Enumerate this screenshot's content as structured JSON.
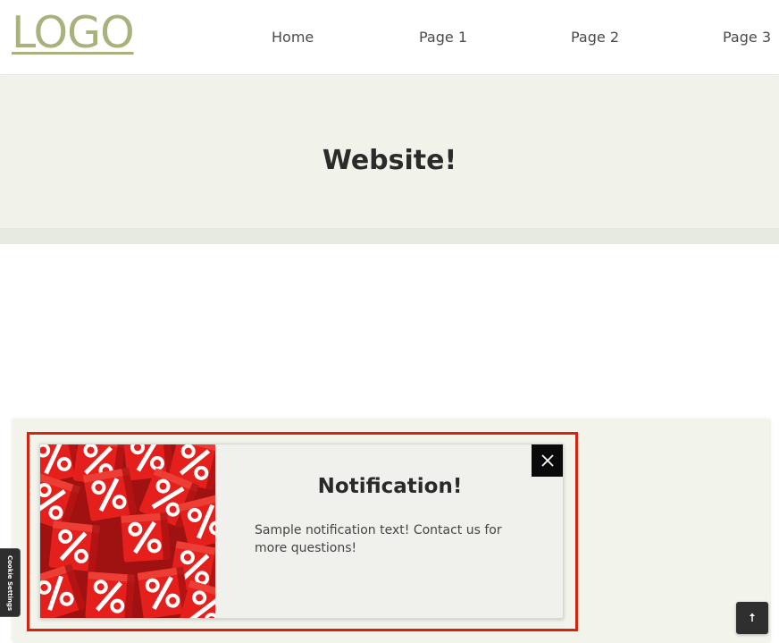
{
  "header": {
    "logo_text": "LOGO",
    "nav": [
      {
        "label": "Home"
      },
      {
        "label": "Page 1"
      },
      {
        "label": "Page 2"
      },
      {
        "label": "Page 3"
      }
    ]
  },
  "hero": {
    "title": "Website!"
  },
  "notification": {
    "title": "Notification!",
    "text": "Sample notification text! Contact us for more questions!",
    "image_icon": "percent-cubes-image",
    "close_icon": "close-icon"
  },
  "cookie_settings": {
    "label": "Cookie Settings"
  },
  "scroll_top": {
    "icon": "arrow-up-icon"
  },
  "colors": {
    "logo": "#a9b27c",
    "hero_bg": "#f1f3ea",
    "highlight": "#d4230f",
    "image_red": "#e11b1b"
  }
}
